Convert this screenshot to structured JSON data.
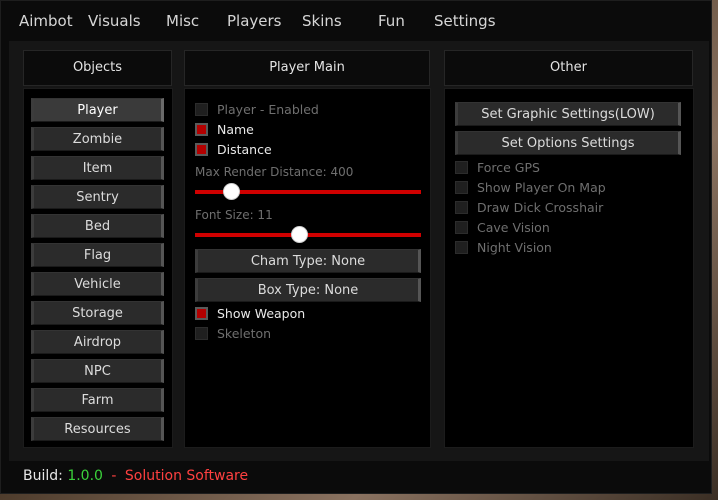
{
  "menu": {
    "items": [
      "Aimbot",
      "Visuals",
      "Misc",
      "Players",
      "Skins",
      "Fun",
      "Settings"
    ]
  },
  "objects": {
    "title": "Objects",
    "items": [
      "Player",
      "Zombie",
      "Item",
      "Sentry",
      "Bed",
      "Flag",
      "Vehicle",
      "Storage",
      "Airdrop",
      "NPC",
      "Farm",
      "Resources"
    ],
    "selected": "Player"
  },
  "player_main": {
    "title": "Player Main",
    "enabled_label": "Player - Enabled",
    "name_label": "Name",
    "distance_label": "Distance",
    "max_render_label": "Max Render Distance: 400",
    "max_render_fraction": 0.16,
    "font_size_label": "Font Size: 11",
    "font_size_fraction": 0.46,
    "cham_type_label": "Cham Type: None",
    "box_type_label": "Box Type: None",
    "show_weapon_label": "Show Weapon",
    "skeleton_label": "Skeleton",
    "checked": {
      "enabled": false,
      "name": true,
      "distance": true,
      "show_weapon": true,
      "skeleton": false
    }
  },
  "other": {
    "title": "Other",
    "graphic_button": "Set Graphic Settings(LOW)",
    "options_button": "Set Options Settings",
    "force_gps": "Force GPS",
    "show_player_on_map": "Show Player On Map",
    "draw_crosshair": "Draw Dick Crosshair",
    "cave_vision": "Cave Vision",
    "night_vision": "Night Vision"
  },
  "footer": {
    "build_label": "Build:",
    "version": "1.0.0",
    "separator": "-",
    "brand": "Solution Software"
  },
  "colors": {
    "accent_red": "#d00000",
    "version_green": "#3bd23b",
    "brand_red": "#ff4040"
  }
}
